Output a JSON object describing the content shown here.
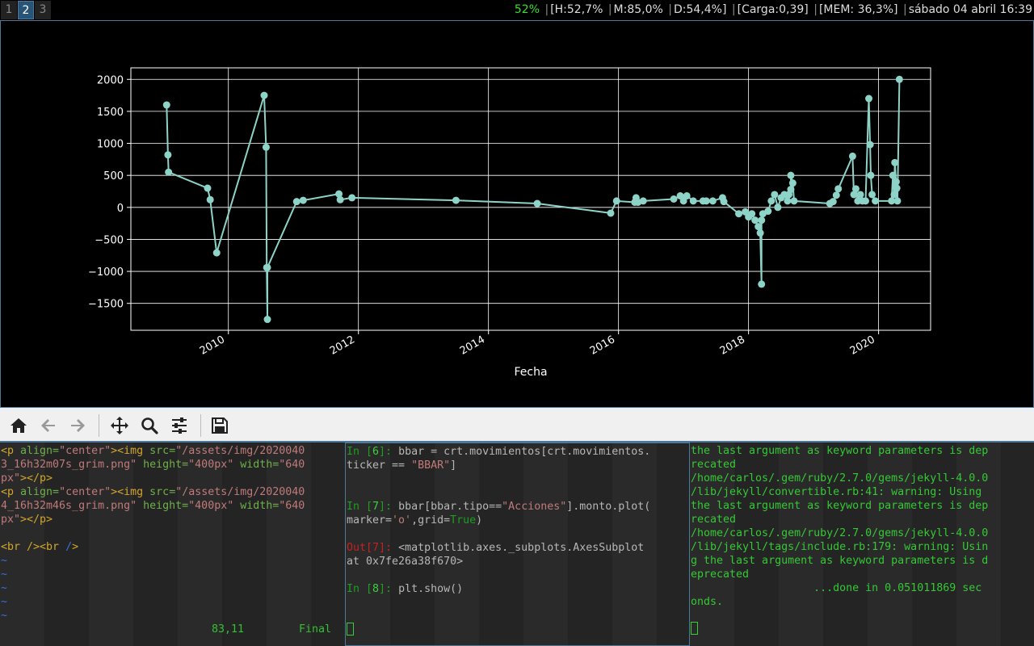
{
  "workspaces": [
    {
      "label": "1",
      "active": false
    },
    {
      "label": "2",
      "active": true
    },
    {
      "label": "3",
      "active": false
    }
  ],
  "status": {
    "battery": "52%",
    "hdd": "[H:52,7%",
    "mem_mount": "M:85,0%",
    "disk": "D:54,4%]",
    "load": "[Carga:0,39]",
    "memory": "[MEM: 36,3%]",
    "datetime": "sábado 04 abril 16:39"
  },
  "colors": {
    "accent": "#4c7899",
    "plot_line": "#8dd3c7",
    "battery_ok": "#37e02c"
  },
  "toolbar": {
    "buttons": [
      "home-icon",
      "back-icon",
      "forward-icon",
      "pan-icon",
      "zoom-icon",
      "configure-subplots-icon",
      "save-icon"
    ]
  },
  "chart_data": {
    "type": "line",
    "marker": "o",
    "grid": true,
    "xlabel": "Fecha",
    "ylabel": "",
    "title": "",
    "xlim": [
      2008.5,
      2020.8
    ],
    "ylim": [
      -1920,
      2180
    ],
    "xticks": [
      "2010",
      "2012",
      "2014",
      "2016",
      "2018",
      "2020"
    ],
    "yticks": [
      "2000",
      "1500",
      "1000",
      "500",
      "0",
      "−1000",
      "−1500",
      "−500"
    ],
    "ytick_values": [
      2000,
      1500,
      1000,
      500,
      0,
      -1000,
      -1500,
      -500
    ],
    "x": [
      2009.05,
      2009.07,
      2009.08,
      2009.68,
      2009.72,
      2009.82,
      2010.55,
      2010.58,
      2010.59,
      2010.6,
      2010.6,
      2011.05,
      2011.15,
      2011.7,
      2011.72,
      2011.9,
      2013.5,
      2014.75,
      2015.88,
      2015.97,
      2016.25,
      2016.27,
      2016.3,
      2016.38,
      2016.85,
      2016.95,
      2017.0,
      2017.05,
      2017.15,
      2017.3,
      2017.35,
      2017.45,
      2017.6,
      2017.62,
      2017.85,
      2017.95,
      2018.0,
      2018.05,
      2018.1,
      2018.15,
      2018.18,
      2018.2,
      2018.2,
      2018.22,
      2018.3,
      2018.35,
      2018.4,
      2018.45,
      2018.5,
      2018.55,
      2018.6,
      2018.62,
      2018.65,
      2018.65,
      2018.68,
      2018.7,
      2019.25,
      2019.3,
      2019.35,
      2019.38,
      2019.6,
      2019.62,
      2019.65,
      2019.68,
      2019.72,
      2019.75,
      2019.8,
      2019.85,
      2019.87,
      2019.88,
      2019.9,
      2019.95,
      2020.2,
      2020.22,
      2020.24,
      2020.25,
      2020.27,
      2020.28,
      2020.29,
      2020.32
    ],
    "y": [
      1600,
      820,
      550,
      300,
      120,
      -710,
      1750,
      940,
      -940,
      -1750,
      -940,
      90,
      110,
      210,
      120,
      150,
      110,
      60,
      -90,
      100,
      80,
      150,
      80,
      100,
      130,
      180,
      100,
      180,
      100,
      100,
      100,
      100,
      150,
      90,
      -100,
      -70,
      -150,
      -100,
      -200,
      -300,
      -400,
      -1200,
      -200,
      -100,
      -60,
      100,
      200,
      0,
      150,
      200,
      100,
      200,
      280,
      500,
      380,
      100,
      60,
      90,
      190,
      290,
      800,
      200,
      290,
      100,
      200,
      100,
      100,
      1700,
      980,
      500,
      200,
      100,
      100,
      500,
      200,
      700,
      400,
      300,
      100,
      2000
    ]
  },
  "term1": {
    "lines": [
      [
        [
          "c-tag",
          "<p "
        ],
        [
          "c-attr",
          "align="
        ],
        [
          "c-str",
          "\"center\""
        ],
        [
          "c-tag",
          ">"
        ],
        [
          "c-tag",
          "<img "
        ],
        [
          "c-attr",
          "src="
        ],
        [
          "c-str",
          "\"/assets/img/2020040"
        ]
      ],
      [
        [
          "c-str",
          "3_16h32m07s_grim.png\" "
        ],
        [
          "c-attr",
          "height="
        ],
        [
          "c-str",
          "\"400px\" "
        ],
        [
          "c-attr",
          "width="
        ],
        [
          "c-str",
          "\"640"
        ]
      ],
      [
        [
          "c-str",
          "px\""
        ],
        [
          "c-tag",
          "></p>"
        ]
      ],
      [
        [
          "c-tag",
          "<p "
        ],
        [
          "c-attr",
          "align="
        ],
        [
          "c-str",
          "\"center\""
        ],
        [
          "c-tag",
          ">"
        ],
        [
          "c-tag",
          "<img "
        ],
        [
          "c-attr",
          "src="
        ],
        [
          "c-str",
          "\"/assets/img/2020040"
        ]
      ],
      [
        [
          "c-str",
          "4_16h32m46s_grim.png\" "
        ],
        [
          "c-attr",
          "height="
        ],
        [
          "c-str",
          "\"400px\" "
        ],
        [
          "c-attr",
          "width="
        ],
        [
          "c-str",
          "\"640"
        ]
      ],
      [
        [
          "c-str",
          "px\""
        ],
        [
          "c-tag",
          "></p>"
        ]
      ],
      [
        [
          "c-dim",
          ""
        ]
      ],
      [
        [
          "c-tag",
          "<br "
        ],
        [
          "c-tag",
          "/>"
        ],
        [
          "c-tag",
          "<br "
        ],
        [
          "c-blue",
          "/"
        ],
        [
          "c-tag",
          ">"
        ]
      ],
      [
        [
          "c-blue",
          "~"
        ]
      ],
      [
        [
          "c-blue",
          "~"
        ]
      ],
      [
        [
          "c-blue",
          "~"
        ]
      ],
      [
        [
          "c-blue",
          "~"
        ]
      ],
      [
        [
          "c-blue",
          "~"
        ]
      ]
    ],
    "position": "83,11",
    "mode": "Final"
  },
  "term2": {
    "lines": [
      [
        [
          "c-in",
          "In ["
        ],
        [
          "c-num",
          "6"
        ],
        [
          "c-in",
          "]: "
        ],
        [
          "c-code",
          "bbar = crt.movimientos[crt.movimientos."
        ]
      ],
      [
        [
          "c-code",
          "ticker == "
        ],
        [
          "c-str",
          "\"BBAR\""
        ],
        [
          "c-code",
          "]"
        ]
      ],
      [
        [
          "c-dim",
          ""
        ]
      ],
      [
        [
          "c-dim",
          ""
        ]
      ],
      [
        [
          "c-in",
          "In ["
        ],
        [
          "c-num",
          "7"
        ],
        [
          "c-in",
          "]: "
        ],
        [
          "c-code",
          "bbar[bbar.tipo=="
        ],
        [
          "c-str",
          "\"Acciones\""
        ],
        [
          "c-code",
          "].monto.plot("
        ]
      ],
      [
        [
          "c-code",
          "marker="
        ],
        [
          "c-str",
          "'o'"
        ],
        [
          "c-code",
          ",grid="
        ],
        [
          "c-in",
          "True"
        ],
        [
          "c-code",
          ")"
        ]
      ],
      [
        [
          "c-dim",
          ""
        ]
      ],
      [
        [
          "c-out",
          "Out["
        ],
        [
          "c-out",
          "7"
        ],
        [
          "c-out",
          "]: "
        ],
        [
          "c-code",
          "<matplotlib.axes._subplots.AxesSubplot"
        ]
      ],
      [
        [
          "c-code",
          "at 0x7fe26a38f670>"
        ]
      ],
      [
        [
          "c-dim",
          ""
        ]
      ],
      [
        [
          "c-in",
          "In ["
        ],
        [
          "c-num",
          "8"
        ],
        [
          "c-in",
          "]: "
        ],
        [
          "c-code",
          "plt.show()"
        ]
      ]
    ]
  },
  "term3": {
    "lines": [
      "the last argument as keyword parameters is dep",
      "recated",
      "/home/carlos/.gem/ruby/2.7.0/gems/jekyll-4.0.0",
      "/lib/jekyll/convertible.rb:41: warning: Using",
      "the last argument as keyword parameters is dep",
      "recated",
      "/home/carlos/.gem/ruby/2.7.0/gems/jekyll-4.0.0",
      "/lib/jekyll/tags/include.rb:179: warning: Usin",
      "g the last argument as keyword parameters is d",
      "eprecated",
      "                   ...done in 0.051011869 sec",
      "onds."
    ]
  }
}
